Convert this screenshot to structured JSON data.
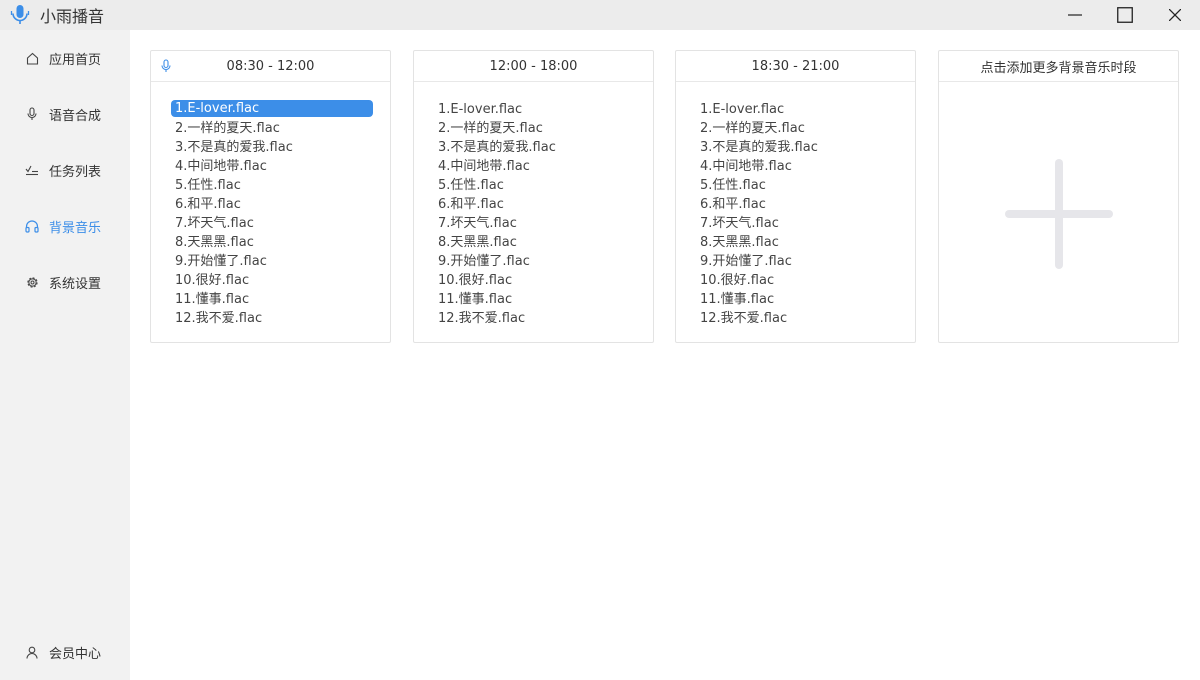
{
  "window": {
    "title": "小雨播音",
    "controls": {
      "minimize_icon": "minimize-icon",
      "maximize_icon": "maximize-icon",
      "close_icon": "close-icon"
    }
  },
  "sidebar": {
    "items": [
      {
        "label": "应用首页",
        "icon": "home-icon"
      },
      {
        "label": "语音合成",
        "icon": "microphone-icon"
      },
      {
        "label": "任务列表",
        "icon": "task-list-icon"
      },
      {
        "label": "背景音乐",
        "icon": "headphones-icon",
        "active": true
      },
      {
        "label": "系统设置",
        "icon": "gear-icon"
      }
    ],
    "footer_item": {
      "label": "会员中心",
      "icon": "user-icon"
    }
  },
  "colors": {
    "accent": "#3c8ee8",
    "sidebar_bg": "#f2f2f2",
    "titlebar_bg": "#ececec"
  },
  "cards": [
    {
      "time_range": "08:30 - 12:00",
      "header_icon": "microphone-icon",
      "selected_index": 0,
      "songs": [
        "1.E-lover.flac",
        "2.一样的夏天.flac",
        "3.不是真的爱我.flac",
        "4.中间地带.flac",
        "5.任性.flac",
        "6.和平.flac",
        "7.坏天气.flac",
        "8.天黑黑.flac",
        "9.开始懂了.flac",
        "10.很好.flac",
        "11.懂事.flac",
        "12.我不爱.flac"
      ]
    },
    {
      "time_range": "12:00 - 18:00",
      "songs": [
        "1.E-lover.flac",
        "2.一样的夏天.flac",
        "3.不是真的爱我.flac",
        "4.中间地带.flac",
        "5.任性.flac",
        "6.和平.flac",
        "7.坏天气.flac",
        "8.天黑黑.flac",
        "9.开始懂了.flac",
        "10.很好.flac",
        "11.懂事.flac",
        "12.我不爱.flac"
      ]
    },
    {
      "time_range": "18:30 - 21:00",
      "songs": [
        "1.E-lover.flac",
        "2.一样的夏天.flac",
        "3.不是真的爱我.flac",
        "4.中间地带.flac",
        "5.任性.flac",
        "6.和平.flac",
        "7.坏天气.flac",
        "8.天黑黑.flac",
        "9.开始懂了.flac",
        "10.很好.flac",
        "11.懂事.flac",
        "12.我不爱.flac"
      ]
    }
  ],
  "add_card": {
    "title": "点击添加更多背景音乐时段",
    "icon": "plus-icon"
  }
}
